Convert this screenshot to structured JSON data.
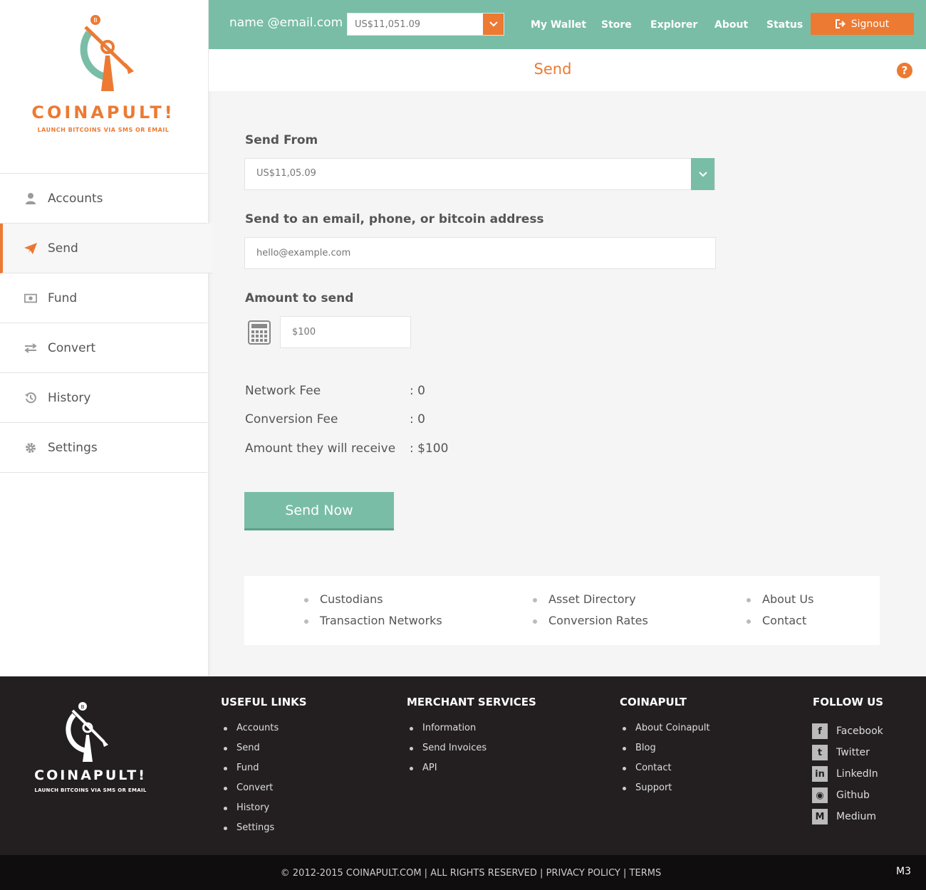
{
  "brand": {
    "name": "COINAPULT!",
    "tagline": "LAUNCH BITCOINS VIA SMS OR EMAIL",
    "accent": "#ec7a33",
    "teal": "#79bda7"
  },
  "sidebar": {
    "items": [
      {
        "label": "Accounts",
        "icon": "user-icon"
      },
      {
        "label": "Send",
        "icon": "paper-plane-icon",
        "active": true
      },
      {
        "label": "Fund",
        "icon": "money-icon"
      },
      {
        "label": "Convert",
        "icon": "exchange-icon"
      },
      {
        "label": "History",
        "icon": "history-icon"
      },
      {
        "label": "Settings",
        "icon": "gear-icon"
      }
    ]
  },
  "topbar": {
    "email": "name @email.com",
    "balance": "US$11,051.09",
    "links": [
      "My Wallet",
      "Store",
      "Explorer",
      "About",
      "Status"
    ],
    "signout": "Signout"
  },
  "page": {
    "title": "Send",
    "help": "?"
  },
  "form": {
    "send_from_label": "Send From",
    "send_from_value": "US$11,05.09",
    "recipient_label": "Send to an email, phone, or bitcoin address",
    "recipient_placeholder": "hello@example.com",
    "amount_label": "Amount to send",
    "amount_placeholder": "$100",
    "fees": [
      {
        "label": "Network Fee",
        "value": ": 0"
      },
      {
        "label": "Conversion Fee",
        "value": ": 0"
      },
      {
        "label": "Amount they will receive",
        "value": ": $100"
      }
    ],
    "submit": "Send Now"
  },
  "bottom_links": [
    [
      "Custodians",
      "Transaction Networks"
    ],
    [
      "Asset Directory",
      "Conversion Rates"
    ],
    [
      "About Us",
      "Contact"
    ]
  ],
  "footer": {
    "useful_links": {
      "title": "USEFUL LINKS",
      "items": [
        "Accounts",
        "Send",
        "Fund",
        "Convert",
        "History",
        "Settings"
      ]
    },
    "merchant_services": {
      "title": "MERCHANT SERVICES",
      "items": [
        "Information",
        "Send Invoices",
        "API"
      ]
    },
    "coinapult": {
      "title": "COINAPULT",
      "items": [
        "About Coinapult",
        "Blog",
        "Contact",
        "Support"
      ]
    },
    "follow_us": {
      "title": "FOLLOW US",
      "items": [
        {
          "label": "Facebook",
          "icon": "facebook-icon",
          "glyph": "f"
        },
        {
          "label": "Twitter",
          "icon": "twitter-icon",
          "glyph": "t"
        },
        {
          "label": "LinkedIn",
          "icon": "linkedin-icon",
          "glyph": "in"
        },
        {
          "label": "Github",
          "icon": "github-icon",
          "glyph": "◉"
        },
        {
          "label": "Medium",
          "icon": "medium-icon",
          "glyph": "M"
        }
      ]
    },
    "copyright": "© 2012-2015 COINAPULT.COM",
    "sep": "|",
    "rights": "ALL RIGHTS RESERVED",
    "privacy": "PRIVACY POLICY",
    "terms": "TERMS",
    "version": "M3"
  }
}
